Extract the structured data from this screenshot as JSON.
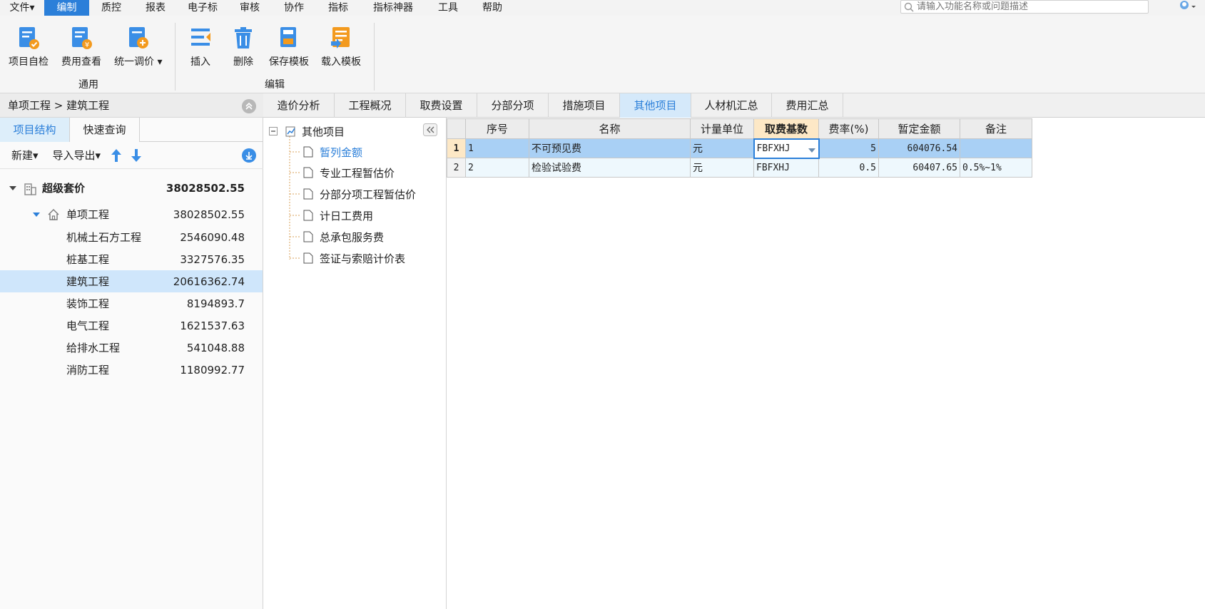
{
  "menu": {
    "items": [
      "文件▾",
      "编制",
      "质控",
      "报表",
      "电子标",
      "审核",
      "协作",
      "指标",
      "指标神器",
      "工具",
      "帮助"
    ],
    "active_index": 1,
    "search_placeholder": "请输入功能名称或问题描述"
  },
  "ribbon": {
    "buttons": {
      "self_check": "项目自检",
      "fee_view": "费用查看",
      "unify_price": "统一调价",
      "insert": "插入",
      "delete": "删除",
      "save_template": "保存模板",
      "load_template": "载入模板"
    },
    "groups": {
      "general": "通用",
      "edit": "编辑"
    }
  },
  "left": {
    "breadcrumb": "单项工程 > 建筑工程",
    "tabs": [
      "项目结构",
      "快速查询"
    ],
    "toolbar": {
      "new": "新建▾",
      "import_export": "导入导出▾"
    },
    "tree": [
      {
        "name": "超级套价",
        "value": "38028502.55"
      },
      {
        "name": "单项工程",
        "value": "38028502.55"
      },
      {
        "name": "机械土石方工程",
        "value": "2546090.48"
      },
      {
        "name": "桩基工程",
        "value": "3327576.35"
      },
      {
        "name": "建筑工程",
        "value": "20616362.74"
      },
      {
        "name": "装饰工程",
        "value": "8194893.7"
      },
      {
        "name": "电气工程",
        "value": "1621537.63"
      },
      {
        "name": "给排水工程",
        "value": "541048.88"
      },
      {
        "name": "消防工程",
        "value": "1180992.77"
      }
    ]
  },
  "main_tabs": [
    "造价分析",
    "工程概况",
    "取费设置",
    "分部分项",
    "措施项目",
    "其他项目",
    "人材机汇总",
    "费用汇总"
  ],
  "mid_tree": {
    "root": "其他项目",
    "children": [
      "暂列金额",
      "专业工程暂估价",
      "分部分项工程暂估价",
      "计日工费用",
      "总承包服务费",
      "签证与索赔计价表"
    ]
  },
  "grid": {
    "headers": [
      "序号",
      "名称",
      "计量单位",
      "取费基数",
      "费率(%)",
      "暂定金额",
      "备注"
    ],
    "rows": [
      {
        "rownum": "1",
        "seq": "1",
        "name": "不可预见费",
        "unit": "元",
        "base": "FBFXHJ",
        "rate": "5",
        "amount": "604076.54",
        "note": ""
      },
      {
        "rownum": "2",
        "seq": "2",
        "name": "检验试验费",
        "unit": "元",
        "base": "FBFXHJ",
        "rate": "0.5",
        "amount": "60407.65",
        "note": "0.5%~1%"
      }
    ]
  },
  "colors": {
    "accent": "#2b7fd9",
    "selected_row": "#a9d0f5",
    "header_highlight": "#fde8c6"
  }
}
